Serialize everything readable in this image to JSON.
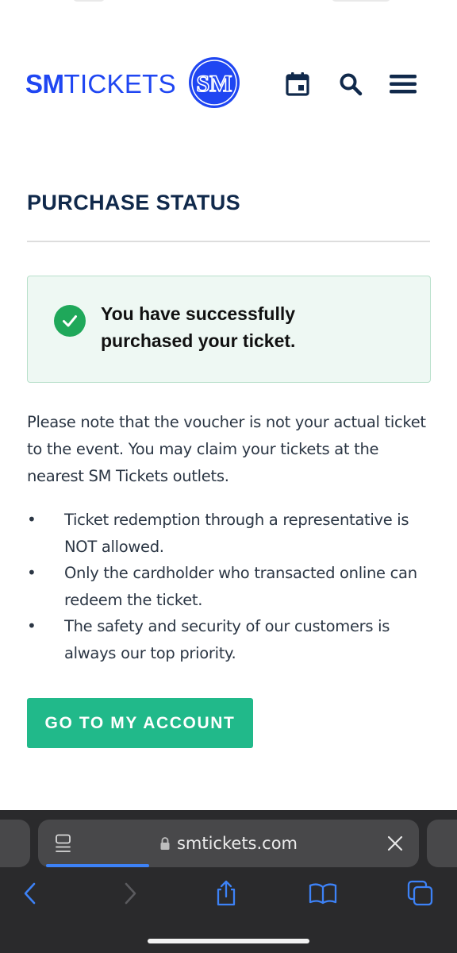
{
  "site": {
    "brand_bold": "SM",
    "brand_thin": "TICKETS",
    "logo_letters": "SM",
    "icons": [
      "calendar-icon",
      "search-icon",
      "menu-icon"
    ]
  },
  "page": {
    "title": "PURCHASE STATUS"
  },
  "alert": {
    "line1": "You have successfully",
    "line2": "purchased your ticket."
  },
  "note": "Please note that the voucher is not your actual ticket to the event. You may claim your tickets at the nearest SM Tickets outlets.",
  "bullets": [
    "Ticket redemption through a representative is NOT allowed.",
    "Only the cardholder who transacted online can redeem the ticket.",
    "The safety and security of our customers is always our top priority."
  ],
  "cta_label": "GO TO MY ACCOUNT",
  "browser": {
    "url": "smtickets.com",
    "toolbar_icons": [
      "back-icon",
      "forward-icon",
      "share-icon",
      "bookmarks-icon",
      "tabs-icon"
    ]
  },
  "colors": {
    "brand_blue": "#1f46f2",
    "title_navy": "#10294b",
    "success_green": "#1fa85a",
    "cta_teal": "#21b98a",
    "ios_blue": "#3d82f7"
  }
}
